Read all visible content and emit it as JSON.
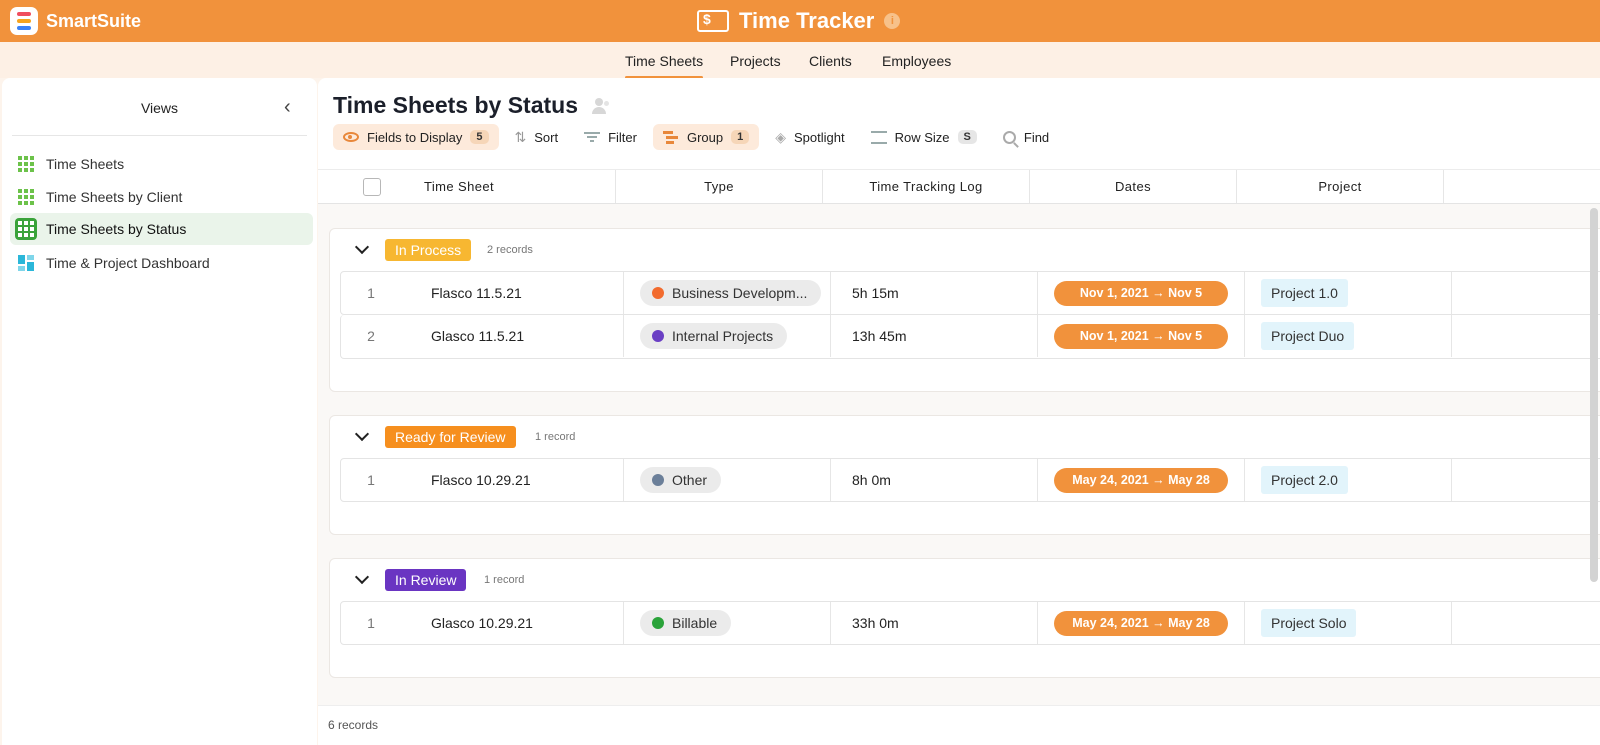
{
  "brand": {
    "name": "SmartSuite"
  },
  "app": {
    "title": "Time Tracker",
    "info": "i"
  },
  "subnav": {
    "tabs": [
      "Time Sheets",
      "Projects",
      "Clients",
      "Employees"
    ]
  },
  "sidebar": {
    "title": "Views",
    "items": [
      {
        "label": "Time Sheets"
      },
      {
        "label": "Time Sheets by Client"
      },
      {
        "label": "Time Sheets by Status"
      },
      {
        "label": "Time & Project Dashboard"
      }
    ]
  },
  "main": {
    "title": "Time Sheets by Status",
    "toolbar": {
      "fields_label": "Fields to Display",
      "fields_count": "5",
      "sort_label": "Sort",
      "filter_label": "Filter",
      "group_label": "Group",
      "group_count": "1",
      "spotlight_label": "Spotlight",
      "rowsize_label": "Row Size",
      "rowsize_value": "S",
      "find_label": "Find"
    },
    "columns": [
      "Time Sheet",
      "Type",
      "Time Tracking Log",
      "Dates",
      "Project"
    ],
    "groups": [
      {
        "status": "In Process",
        "color": "#f7b731",
        "count_label": "2 records",
        "rows": [
          {
            "num": "1",
            "name": "Flasco 11.5.21",
            "type": "Business Developm...",
            "type_color": "#f26b2e",
            "log": "5h 15m",
            "dates": "Nov 1, 2021 → Nov 5",
            "project": "Project 1.0"
          },
          {
            "num": "2",
            "name": "Glasco 11.5.21",
            "type": "Internal Projects",
            "type_color": "#6a3fc4",
            "log": "13h 45m",
            "dates": "Nov 1, 2021 → Nov 5",
            "project": "Project Duo"
          }
        ]
      },
      {
        "status": "Ready for Review",
        "color": "#f68f1e",
        "count_label": "1 record",
        "rows": [
          {
            "num": "1",
            "name": "Flasco 10.29.21",
            "type": "Other",
            "type_color": "#6b7f99",
            "log": "8h 0m",
            "dates": "May 24, 2021 → May 28",
            "project": "Project 2.0"
          }
        ]
      },
      {
        "status": "In Review",
        "color": "#6a35c2",
        "count_label": "1 record",
        "rows": [
          {
            "num": "1",
            "name": "Glasco 10.29.21",
            "type": "Billable",
            "type_color": "#2aa33a",
            "log": "33h 0m",
            "dates": "May 24, 2021 → May 28",
            "project": "Project Solo"
          }
        ]
      }
    ],
    "footer": "6 records"
  }
}
